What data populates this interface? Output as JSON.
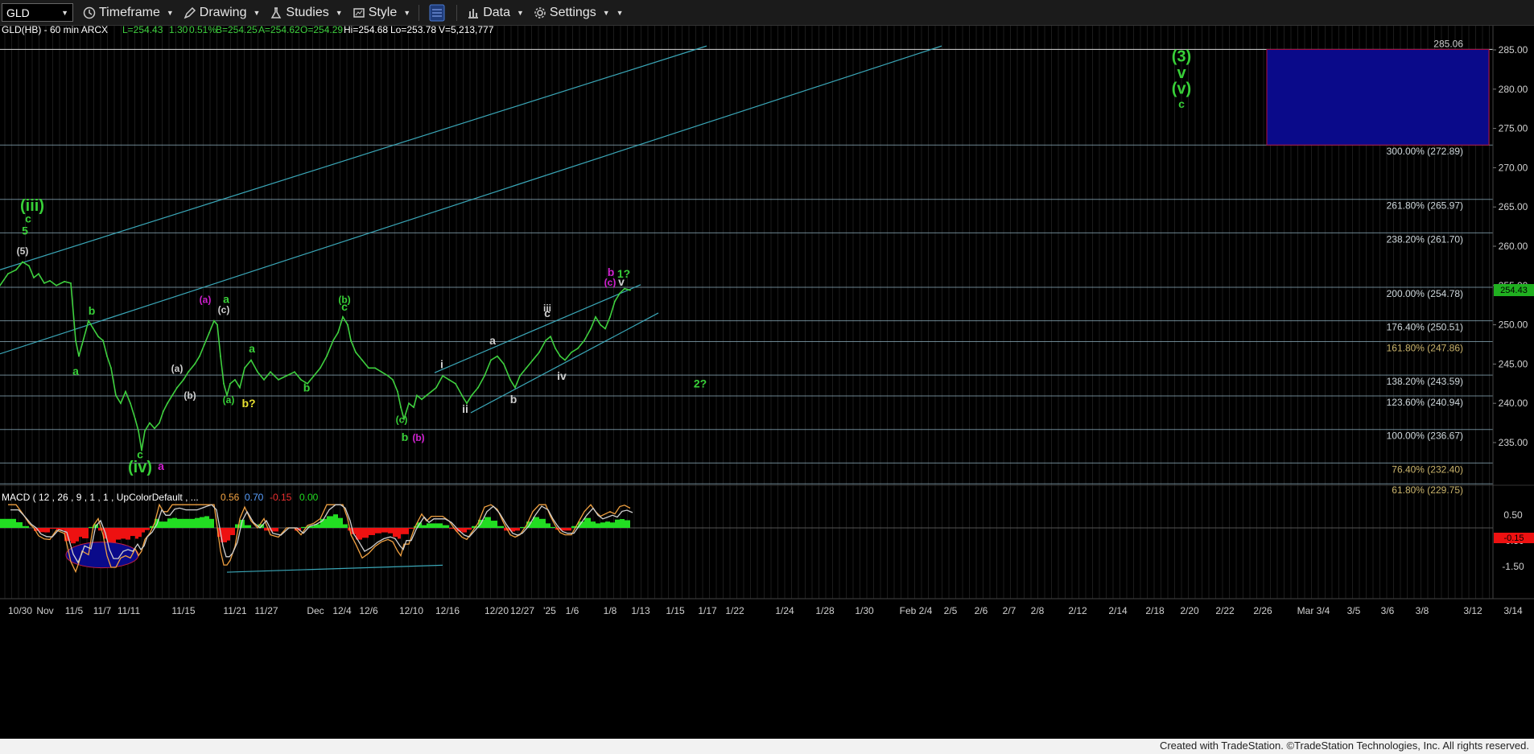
{
  "toolbar": {
    "symbol": "GLD",
    "items": [
      "Timeframe",
      "Drawing",
      "Studies",
      "Style",
      "Data",
      "Settings"
    ]
  },
  "info_bar": {
    "symbol": "GLD(HB) - 60 min  ARCX",
    "last": "L=254.43",
    "change": "1.30",
    "change_pct": "0.51%",
    "bid": "B=254.25",
    "ask": "A=254.62",
    "open": "O=254.29",
    "high": "Hi=254.68",
    "low": "Lo=253.78",
    "volume": "V=5,213,777"
  },
  "macd_header": {
    "text": "MACD ( 12 , 26 , 9 , 1 , 1 , UpColorDefault , ...",
    "v1": "0.56",
    "v2": "0.70",
    "v3": "-0.15",
    "v4": "0.00"
  },
  "footer_text": "Created with TradeStation. ©TradeStation Technologies, Inc. All rights reserved.",
  "colors": {
    "price": "#3ecf3e",
    "channel": "#3aa7b8",
    "fib_line": "#8fb0c0",
    "target_box": "#0a0a8a",
    "label_green": "#38d038",
    "label_magenta": "#d020d0",
    "label_yellow": "#e8e030",
    "price_tag": "#20b020",
    "macd_up": "#22dd22",
    "macd_down": "#ee1111",
    "macd_line": "#f0a040",
    "macd_signal": "#cfcfcf",
    "macd_ellipse": "#0a0a8a"
  },
  "chart_data": {
    "type": "line",
    "title": "GLD(HB) - 60 min",
    "ylim": [
      229,
      287
    ],
    "y_ticks": [
      235,
      240,
      245,
      250,
      255,
      260,
      265,
      270,
      275,
      280,
      285
    ],
    "current_price": "254.43",
    "x_ticks": [
      "10/30",
      "Nov",
      "11/5",
      "11/7",
      "11/11",
      "11/15",
      "11/21",
      "11/27",
      "Dec",
      "12/4",
      "12/6",
      "12/10",
      "12/16",
      "12/20",
      "12/27",
      "'25",
      "1/6",
      "1/8",
      "1/13",
      "1/15",
      "1/17",
      "1/22",
      "1/24",
      "1/28",
      "1/30",
      "Feb 2/4",
      "2/5",
      "2/6",
      "2/7",
      "2/8",
      "2/12",
      "2/14",
      "2/18",
      "2/20",
      "2/22",
      "2/26",
      "Mar 3/4",
      "3/5",
      "3/6",
      "3/8",
      "3/12",
      "3/14"
    ],
    "fib_levels": [
      {
        "label": "300.00% (272.89)",
        "value": 272.89
      },
      {
        "label": "261.80% (265.97)",
        "value": 265.97
      },
      {
        "label": "238.20% (261.70)",
        "value": 261.7
      },
      {
        "label": "200.00% (254.78)",
        "value": 254.78
      },
      {
        "label": "176.40% (250.51)",
        "value": 250.51
      },
      {
        "label": "161.80% (247.86)",
        "value": 247.86
      },
      {
        "label": "138.20% (243.59)",
        "value": 243.59
      },
      {
        "label": "123.60% (240.94)",
        "value": 240.94
      },
      {
        "label": "100.00% (236.67)",
        "value": 236.67
      },
      {
        "label": "76.40% (232.40)",
        "value": 232.4
      },
      {
        "label": "61.80% (229.75)",
        "value": 229.75
      }
    ],
    "top_level": {
      "label": "285.06",
      "value": 285.06
    },
    "target_box": {
      "from": 272.89,
      "to": 285.06
    },
    "price_series": [
      {
        "x": 0,
        "y": 255.0
      },
      {
        "x": 10,
        "y": 256.5
      },
      {
        "x": 20,
        "y": 257.0
      },
      {
        "x": 28,
        "y": 258.0
      },
      {
        "x": 36,
        "y": 257.5
      },
      {
        "x": 42,
        "y": 256.0
      },
      {
        "x": 48,
        "y": 256.5
      },
      {
        "x": 55,
        "y": 255.3
      },
      {
        "x": 62,
        "y": 255.6
      },
      {
        "x": 70,
        "y": 255.0
      },
      {
        "x": 80,
        "y": 255.5
      },
      {
        "x": 88,
        "y": 255.3
      },
      {
        "x": 94,
        "y": 248.0
      },
      {
        "x": 98,
        "y": 246.0
      },
      {
        "x": 102,
        "y": 247.5
      },
      {
        "x": 110,
        "y": 250.5
      },
      {
        "x": 116,
        "y": 249.5
      },
      {
        "x": 122,
        "y": 248.5
      },
      {
        "x": 128,
        "y": 248.0
      },
      {
        "x": 133,
        "y": 246.0
      },
      {
        "x": 138,
        "y": 244.5
      },
      {
        "x": 144,
        "y": 241.0
      },
      {
        "x": 150,
        "y": 240.0
      },
      {
        "x": 156,
        "y": 241.5
      },
      {
        "x": 162,
        "y": 240.0
      },
      {
        "x": 168,
        "y": 238.0
      },
      {
        "x": 172,
        "y": 236.5
      },
      {
        "x": 176,
        "y": 234.0
      },
      {
        "x": 180,
        "y": 236.5
      },
      {
        "x": 186,
        "y": 237.5
      },
      {
        "x": 192,
        "y": 236.8
      },
      {
        "x": 198,
        "y": 237.5
      },
      {
        "x": 203,
        "y": 239.0
      },
      {
        "x": 208,
        "y": 240.0
      },
      {
        "x": 214,
        "y": 241.0
      },
      {
        "x": 220,
        "y": 242.0
      },
      {
        "x": 228,
        "y": 243.0
      },
      {
        "x": 234,
        "y": 244.0
      },
      {
        "x": 242,
        "y": 245.0
      },
      {
        "x": 248,
        "y": 246.0
      },
      {
        "x": 254,
        "y": 247.5
      },
      {
        "x": 260,
        "y": 249.0
      },
      {
        "x": 266,
        "y": 250.5
      },
      {
        "x": 270,
        "y": 250.0
      },
      {
        "x": 274,
        "y": 246.0
      },
      {
        "x": 278,
        "y": 242.5
      },
      {
        "x": 282,
        "y": 241.0
      },
      {
        "x": 286,
        "y": 242.5
      },
      {
        "x": 292,
        "y": 243.0
      },
      {
        "x": 298,
        "y": 242.0
      },
      {
        "x": 304,
        "y": 244.5
      },
      {
        "x": 312,
        "y": 245.5
      },
      {
        "x": 320,
        "y": 244.0
      },
      {
        "x": 328,
        "y": 243.0
      },
      {
        "x": 336,
        "y": 244.0
      },
      {
        "x": 346,
        "y": 243.0
      },
      {
        "x": 356,
        "y": 243.5
      },
      {
        "x": 366,
        "y": 244.0
      },
      {
        "x": 374,
        "y": 243.0
      },
      {
        "x": 382,
        "y": 242.5
      },
      {
        "x": 390,
        "y": 243.5
      },
      {
        "x": 398,
        "y": 244.5
      },
      {
        "x": 406,
        "y": 246.0
      },
      {
        "x": 414,
        "y": 248.0
      },
      {
        "x": 420,
        "y": 249.0
      },
      {
        "x": 426,
        "y": 251.0
      },
      {
        "x": 432,
        "y": 250.0
      },
      {
        "x": 436,
        "y": 248.0
      },
      {
        "x": 442,
        "y": 246.5
      },
      {
        "x": 450,
        "y": 245.5
      },
      {
        "x": 458,
        "y": 244.5
      },
      {
        "x": 466,
        "y": 244.5
      },
      {
        "x": 474,
        "y": 244.0
      },
      {
        "x": 482,
        "y": 243.5
      },
      {
        "x": 488,
        "y": 243.0
      },
      {
        "x": 494,
        "y": 241.5
      },
      {
        "x": 498,
        "y": 239.5
      },
      {
        "x": 502,
        "y": 238.0
      },
      {
        "x": 508,
        "y": 240.0
      },
      {
        "x": 514,
        "y": 239.5
      },
      {
        "x": 518,
        "y": 241.0
      },
      {
        "x": 524,
        "y": 240.5
      },
      {
        "x": 530,
        "y": 241.0
      },
      {
        "x": 536,
        "y": 241.5
      },
      {
        "x": 542,
        "y": 242.0
      },
      {
        "x": 550,
        "y": 243.5
      },
      {
        "x": 558,
        "y": 243.0
      },
      {
        "x": 566,
        "y": 242.5
      },
      {
        "x": 574,
        "y": 241.0
      },
      {
        "x": 580,
        "y": 240.0
      },
      {
        "x": 586,
        "y": 241.0
      },
      {
        "x": 594,
        "y": 242.0
      },
      {
        "x": 602,
        "y": 243.5
      },
      {
        "x": 610,
        "y": 245.5
      },
      {
        "x": 618,
        "y": 246.0
      },
      {
        "x": 626,
        "y": 245.0
      },
      {
        "x": 634,
        "y": 243.0
      },
      {
        "x": 640,
        "y": 242.0
      },
      {
        "x": 646,
        "y": 243.5
      },
      {
        "x": 654,
        "y": 244.5
      },
      {
        "x": 662,
        "y": 245.5
      },
      {
        "x": 670,
        "y": 246.5
      },
      {
        "x": 678,
        "y": 248.0
      },
      {
        "x": 684,
        "y": 248.5
      },
      {
        "x": 690,
        "y": 247.0
      },
      {
        "x": 696,
        "y": 246.0
      },
      {
        "x": 702,
        "y": 245.5
      },
      {
        "x": 710,
        "y": 246.5
      },
      {
        "x": 718,
        "y": 247.0
      },
      {
        "x": 726,
        "y": 248.0
      },
      {
        "x": 734,
        "y": 249.5
      },
      {
        "x": 740,
        "y": 251.0
      },
      {
        "x": 746,
        "y": 250.0
      },
      {
        "x": 752,
        "y": 249.5
      },
      {
        "x": 758,
        "y": 251.0
      },
      {
        "x": 764,
        "y": 253.0
      },
      {
        "x": 770,
        "y": 254.0
      },
      {
        "x": 776,
        "y": 254.6
      },
      {
        "x": 783,
        "y": 254.4
      }
    ],
    "annotations": [
      {
        "text": "(iii)",
        "color": "#38d038",
        "x": 40,
        "y": 264.5
      },
      {
        "text": "c",
        "color": "#38d038",
        "x": 35,
        "y": 263.0
      },
      {
        "text": "5",
        "color": "#38d038",
        "x": 31,
        "y": 261.5
      },
      {
        "text": "(5)",
        "color": "#cfcfcf",
        "x": 28,
        "y": 259.0
      },
      {
        "text": "b",
        "color": "#38d038",
        "x": 114,
        "y": 251.3
      },
      {
        "text": "a",
        "color": "#38d038",
        "x": 94,
        "y": 243.6
      },
      {
        "text": "(iv)",
        "color": "#38d038",
        "x": 174,
        "y": 231.2
      },
      {
        "text": "c",
        "color": "#38d038",
        "x": 174,
        "y": 233.0
      },
      {
        "text": "a",
        "color": "#d020d0",
        "x": 200,
        "y": 231.5
      },
      {
        "text": "(a)",
        "color": "#cfcfcf",
        "x": 220,
        "y": 244.0
      },
      {
        "text": "(b)",
        "color": "#cfcfcf",
        "x": 236,
        "y": 240.6
      },
      {
        "text": "(a)",
        "color": "#d020d0",
        "x": 255,
        "y": 252.8
      },
      {
        "text": "a",
        "color": "#38d038",
        "x": 281,
        "y": 252.8
      },
      {
        "text": "(c)",
        "color": "#cfcfcf",
        "x": 278,
        "y": 251.5
      },
      {
        "text": "(a)",
        "color": "#38d038",
        "x": 284,
        "y": 240.0
      },
      {
        "text": "b?",
        "color": "#e8e030",
        "x": 309,
        "y": 239.5
      },
      {
        "text": "a",
        "color": "#38d038",
        "x": 313,
        "y": 246.5
      },
      {
        "text": "b",
        "color": "#38d038",
        "x": 381,
        "y": 241.5
      },
      {
        "text": "(b)",
        "color": "#38d038",
        "x": 428,
        "y": 252.8
      },
      {
        "text": "c",
        "color": "#38d038",
        "x": 428,
        "y": 251.8
      },
      {
        "text": "(c)",
        "color": "#38d038",
        "x": 499,
        "y": 237.5
      },
      {
        "text": "b",
        "color": "#38d038",
        "x": 503,
        "y": 235.2
      },
      {
        "text": "(b)",
        "color": "#d020d0",
        "x": 520,
        "y": 235.2
      },
      {
        "text": "i",
        "color": "#cfcfcf",
        "x": 549,
        "y": 244.5
      },
      {
        "text": "ii",
        "color": "#cfcfcf",
        "x": 578,
        "y": 238.8
      },
      {
        "text": "a",
        "color": "#cfcfcf",
        "x": 612,
        "y": 247.5
      },
      {
        "text": "b",
        "color": "#cfcfcf",
        "x": 638,
        "y": 240.0
      },
      {
        "text": "iii",
        "color": "#cfcfcf",
        "x": 680,
        "y": 251.7
      },
      {
        "text": "c",
        "color": "#cfcfcf",
        "x": 680,
        "y": 251.0
      },
      {
        "text": "iv",
        "color": "#cfcfcf",
        "x": 698,
        "y": 243.0
      },
      {
        "text": "b",
        "color": "#d020d0",
        "x": 759,
        "y": 256.2
      },
      {
        "text": "(c)",
        "color": "#d020d0",
        "x": 758,
        "y": 255.0
      },
      {
        "text": "1?",
        "color": "#38d038",
        "x": 775,
        "y": 256.0
      },
      {
        "text": "v",
        "color": "#cfcfcf",
        "x": 772,
        "y": 255.0
      },
      {
        "text": "2?",
        "color": "#38d038",
        "x": 870,
        "y": 242.0
      },
      {
        "text": "(3)",
        "color": "#38d038",
        "x": 1468,
        "y": 283.5
      },
      {
        "text": "v",
        "color": "#38d038",
        "x": 1468,
        "y": 281.4
      },
      {
        "text": "(v)",
        "color": "#38d038",
        "x": 1468,
        "y": 279.4
      },
      {
        "text": "c",
        "color": "#38d038",
        "x": 1468,
        "y": 277.6
      }
    ],
    "channels": [
      {
        "x1": 0,
        "y1": 257.0,
        "x2": 878,
        "y2": 285.5
      },
      {
        "x1": 0,
        "y1": 246.3,
        "x2": 1170,
        "y2": 285.5
      },
      {
        "x1": 540,
        "y1": 243.9,
        "x2": 796,
        "y2": 255.1
      },
      {
        "x1": 585,
        "y1": 238.8,
        "x2": 818,
        "y2": 251.5
      }
    ],
    "macd": {
      "ylim": [
        -1.9,
        1.1
      ],
      "y_ticks": [
        0.5,
        -0.5,
        -1.5
      ],
      "current_label": "-0.15",
      "ellipse_x": [
        82,
        172
      ],
      "ellipse_y": [
        -1.55,
        -0.55
      ],
      "trend_line": {
        "x1": 282,
        "y1": -1.72,
        "x2": 550,
        "y2": -1.45
      }
    }
  }
}
